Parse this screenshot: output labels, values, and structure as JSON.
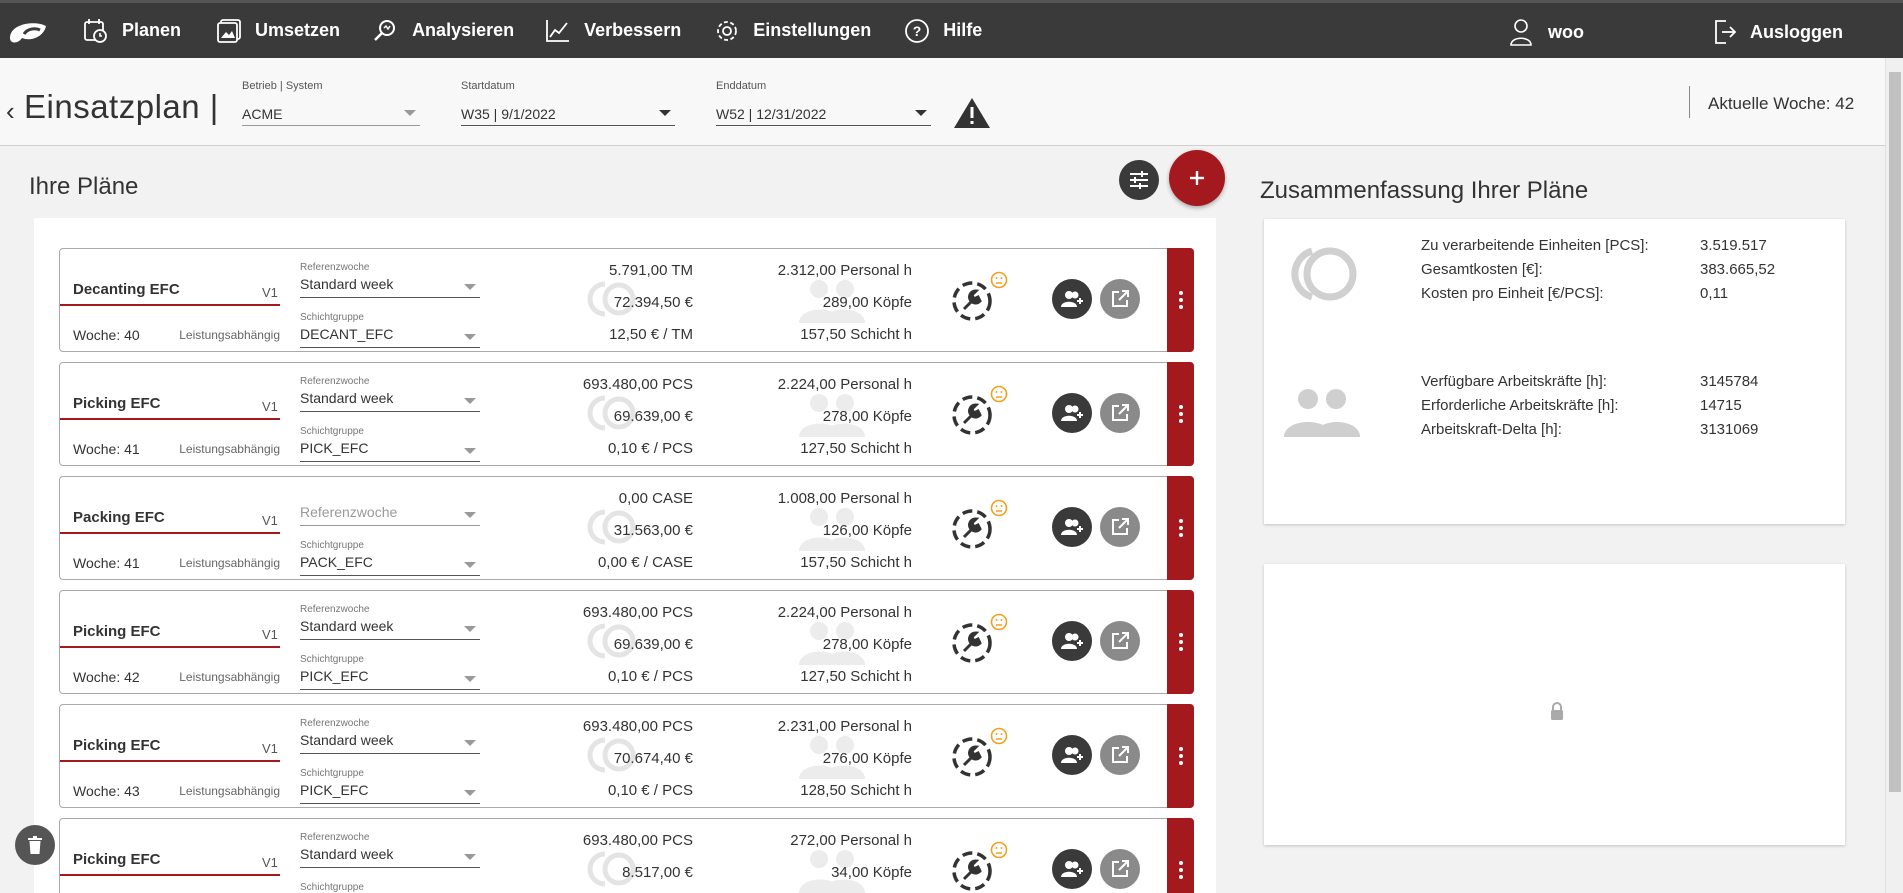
{
  "nav": {
    "items": [
      {
        "label": "Planen",
        "icon": "calendar-clock-icon"
      },
      {
        "label": "Umsetzen",
        "icon": "image-frame-icon"
      },
      {
        "label": "Analysieren",
        "icon": "magnifier-icon"
      },
      {
        "label": "Verbessern",
        "icon": "trend-chart-icon"
      },
      {
        "label": "Einstellungen",
        "icon": "gear-icon"
      },
      {
        "label": "Hilfe",
        "icon": "help-circle-icon"
      }
    ],
    "user": "woo",
    "logout": "Ausloggen"
  },
  "header": {
    "title": "Einsatzplan |",
    "betrieb_label": "Betrieb | System",
    "betrieb_value": "ACME",
    "start_label": "Startdatum",
    "start_value": "W35 | 9/1/2022",
    "end_label": "Enddatum",
    "end_value": "W52 | 12/31/2022",
    "current_week": "Aktuelle Woche: 42"
  },
  "plans_title": "Ihre Pläne",
  "summary_title": "Zusammenfassung Ihrer Pläne",
  "plans": [
    {
      "name": "Decanting EFC",
      "version": "V1",
      "week": "Woche: 40",
      "mode": "Leistungsabhängig",
      "ref_label": "Referenzwoche",
      "ref": "Standard week",
      "ref_placeholder": false,
      "shift_label": "Schichtgruppe",
      "shift": "DECANT_EFC",
      "units": "5.791,00 TM",
      "cost": "72.394,50 €",
      "unit_cost": "12,50 € / TM",
      "personal": "2.312,00 Personal h",
      "heads": "289,00 Köpfe",
      "shift_h": "157,50 Schicht h"
    },
    {
      "name": "Picking EFC",
      "version": "V1",
      "week": "Woche: 41",
      "mode": "Leistungsabhängig",
      "ref_label": "Referenzwoche",
      "ref": "Standard week",
      "ref_placeholder": false,
      "shift_label": "Schichtgruppe",
      "shift": "PICK_EFC",
      "units": "693.480,00 PCS",
      "cost": "69.639,00 €",
      "unit_cost": "0,10 € / PCS",
      "personal": "2.224,00 Personal h",
      "heads": "278,00 Köpfe",
      "shift_h": "127,50 Schicht h"
    },
    {
      "name": "Packing EFC",
      "version": "V1",
      "week": "Woche: 41",
      "mode": "Leistungsabhängig",
      "ref_label": "",
      "ref": "Referenzwoche",
      "ref_placeholder": true,
      "shift_label": "Schichtgruppe",
      "shift": "PACK_EFC",
      "units": "0,00 CASE",
      "cost": "31.563,00 €",
      "unit_cost": "0,00 € / CASE",
      "personal": "1.008,00 Personal h",
      "heads": "126,00 Köpfe",
      "shift_h": "157,50 Schicht h"
    },
    {
      "name": "Picking EFC",
      "version": "V1",
      "week": "Woche: 42",
      "mode": "Leistungsabhängig",
      "ref_label": "Referenzwoche",
      "ref": "Standard week",
      "ref_placeholder": false,
      "shift_label": "Schichtgruppe",
      "shift": "PICK_EFC",
      "units": "693.480,00 PCS",
      "cost": "69.639,00 €",
      "unit_cost": "0,10 € / PCS",
      "personal": "2.224,00 Personal h",
      "heads": "278,00 Köpfe",
      "shift_h": "127,50 Schicht h"
    },
    {
      "name": "Picking EFC",
      "version": "V1",
      "week": "Woche: 43",
      "mode": "Leistungsabhängig",
      "ref_label": "Referenzwoche",
      "ref": "Standard week",
      "ref_placeholder": false,
      "shift_label": "Schichtgruppe",
      "shift": "PICK_EFC",
      "units": "693.480,00 PCS",
      "cost": "70.674,40 €",
      "unit_cost": "0,10 € / PCS",
      "personal": "2.231,00 Personal h",
      "heads": "276,00 Köpfe",
      "shift_h": "128,50 Schicht h"
    },
    {
      "name": "Picking EFC",
      "version": "V1",
      "week": "",
      "mode": "",
      "ref_label": "Referenzwoche",
      "ref": "Standard week",
      "ref_placeholder": false,
      "shift_label": "Schichtgruppe",
      "shift": "",
      "units": "693.480,00 PCS",
      "cost": "8.517,00 €",
      "unit_cost": "",
      "personal": "272,00 Personal h",
      "heads": "34,00 Köpfe",
      "shift_h": ""
    }
  ],
  "summary": {
    "rows_a": [
      {
        "label": "Zu verarbeitende Einheiten [PCS]:",
        "value": "3.519.517"
      },
      {
        "label": "Gesamtkosten [€]:",
        "value": "383.665,52"
      },
      {
        "label": "Kosten pro Einheit [€/PCS]:",
        "value": "0,11"
      }
    ],
    "rows_b": [
      {
        "label": "Verfügbare Arbeitskräfte [h]:",
        "value": "3145784"
      },
      {
        "label": "Erforderliche Arbeitskräfte [h]:",
        "value": "14715"
      },
      {
        "label": "Arbeitskraft-Delta [h]:",
        "value": "3131069"
      }
    ]
  },
  "colors": {
    "accent": "#a3191e",
    "nav_bg": "#3a3a3a",
    "smiley": "#f0a020"
  }
}
